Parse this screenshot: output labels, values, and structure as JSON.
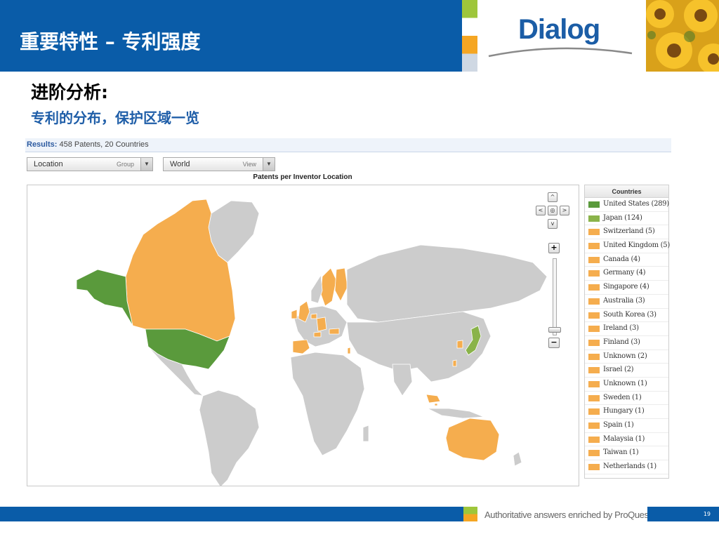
{
  "header": {
    "title": "重要特性 – 专利强度",
    "logo_text": "Dialog"
  },
  "headings": {
    "h1": "进阶分析:",
    "h2": "专利的分布，保护区域一览"
  },
  "results": {
    "label": "Results:",
    "summary": "458 Patents, 20 Countries"
  },
  "dropdowns": [
    {
      "value": "Location",
      "hint": "Group"
    },
    {
      "value": "World",
      "hint": "View"
    }
  ],
  "chart": {
    "title": "Patents per Inventor Location",
    "legend_title": "Countries"
  },
  "colors": {
    "brand_blue": "#0a5ca8",
    "high_green": "#5a9a3c",
    "mid_green": "#8ab34a",
    "orange": "#f5ad4e",
    "no_data_grey": "#cccccc"
  },
  "chart_data": {
    "type": "map",
    "title": "Patents per Inventor Location",
    "legend_title": "Countries",
    "entries": [
      {
        "label": "United States (289)",
        "country": "United States",
        "value": 289,
        "color": "#5a9a3c"
      },
      {
        "label": "Japan (124)",
        "country": "Japan",
        "value": 124,
        "color": "#8ab34a"
      },
      {
        "label": "Switzerland (5)",
        "country": "Switzerland",
        "value": 5,
        "color": "#f5ad4e"
      },
      {
        "label": "United Kingdom (5)",
        "country": "United Kingdom",
        "value": 5,
        "color": "#f5ad4e"
      },
      {
        "label": "Canada (4)",
        "country": "Canada",
        "value": 4,
        "color": "#f5ad4e"
      },
      {
        "label": "Germany (4)",
        "country": "Germany",
        "value": 4,
        "color": "#f5ad4e"
      },
      {
        "label": "Singapore (4)",
        "country": "Singapore",
        "value": 4,
        "color": "#f5ad4e"
      },
      {
        "label": "Australia (3)",
        "country": "Australia",
        "value": 3,
        "color": "#f5ad4e"
      },
      {
        "label": "South Korea (3)",
        "country": "South Korea",
        "value": 3,
        "color": "#f5ad4e"
      },
      {
        "label": "Ireland (3)",
        "country": "Ireland",
        "value": 3,
        "color": "#f5ad4e"
      },
      {
        "label": "Finland (3)",
        "country": "Finland",
        "value": 3,
        "color": "#f5ad4e"
      },
      {
        "label": "Unknown (2)",
        "country": "Unknown",
        "value": 2,
        "color": "#f5ad4e"
      },
      {
        "label": "Israel (2)",
        "country": "Israel",
        "value": 2,
        "color": "#f5ad4e"
      },
      {
        "label": "Unknown (1)",
        "country": "Unknown",
        "value": 1,
        "color": "#f5ad4e"
      },
      {
        "label": "Sweden (1)",
        "country": "Sweden",
        "value": 1,
        "color": "#f5ad4e"
      },
      {
        "label": "Hungary (1)",
        "country": "Hungary",
        "value": 1,
        "color": "#f5ad4e"
      },
      {
        "label": "Spain (1)",
        "country": "Spain",
        "value": 1,
        "color": "#f5ad4e"
      },
      {
        "label": "Malaysia (1)",
        "country": "Malaysia",
        "value": 1,
        "color": "#f5ad4e"
      },
      {
        "label": "Taiwan (1)",
        "country": "Taiwan",
        "value": 1,
        "color": "#f5ad4e"
      },
      {
        "label": "Netherlands (1)",
        "country": "Netherlands",
        "value": 1,
        "color": "#f5ad4e"
      }
    ]
  },
  "map_controls": {
    "up": "^",
    "down": "v",
    "left": "<",
    "right": ">",
    "center": "◎",
    "zoom_in": "+",
    "zoom_out": "−"
  },
  "footer": {
    "tagline": "Authoritative answers enriched by ProQuest.",
    "page_number": "19"
  }
}
